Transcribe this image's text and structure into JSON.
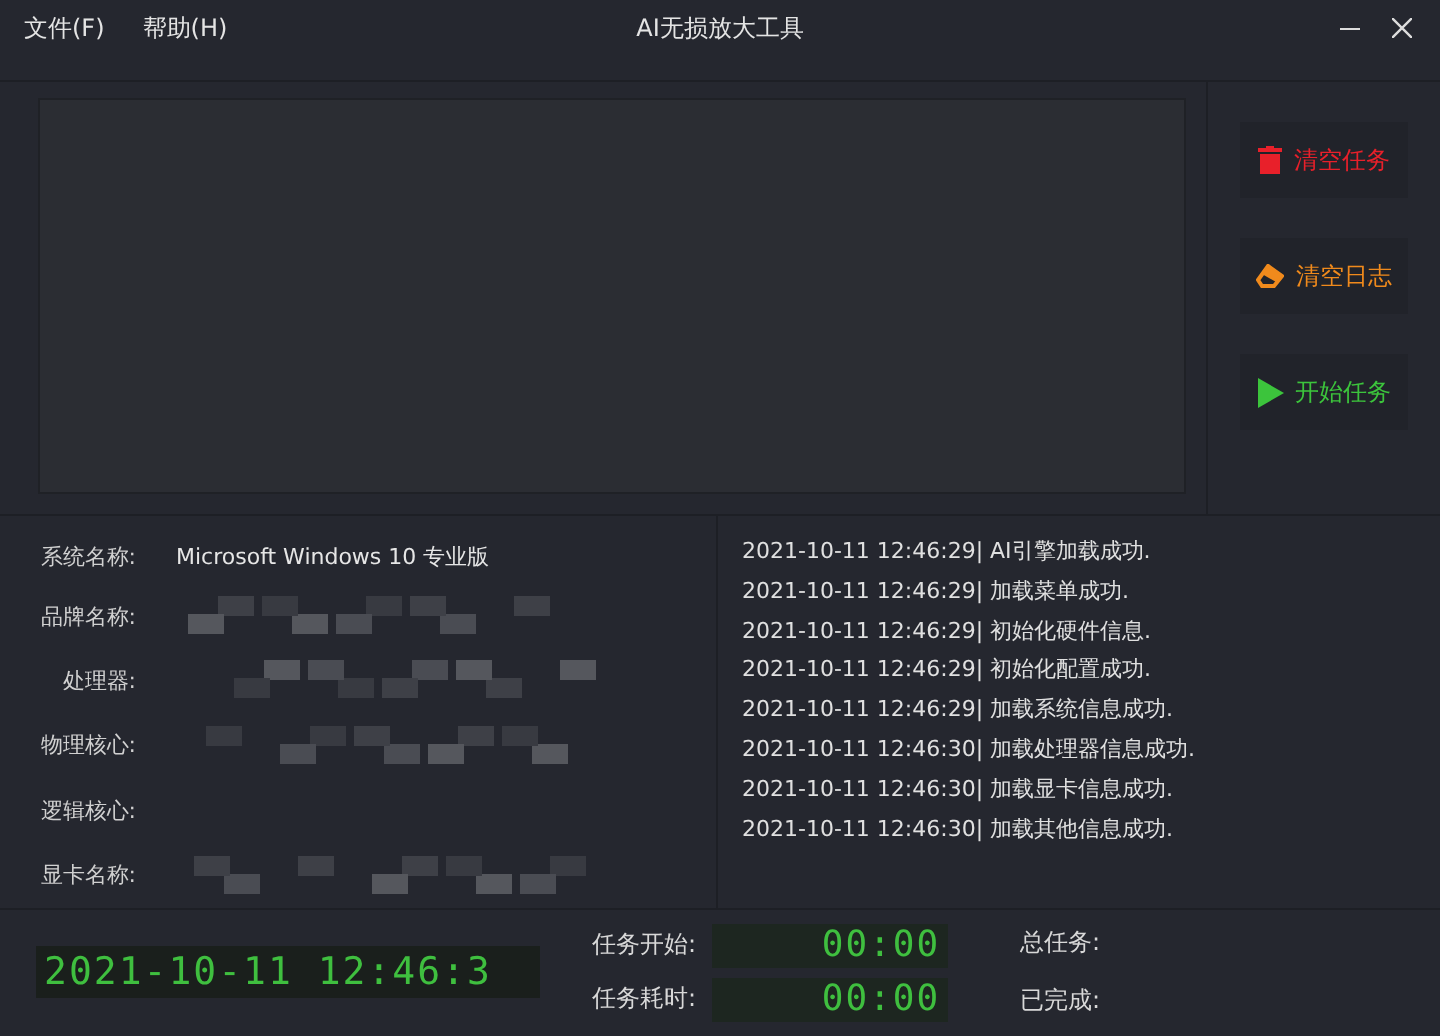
{
  "menu": [
    {
      "label": "文件(F)"
    },
    {
      "label": "帮助(H)"
    }
  ],
  "window": {
    "title": "AI无损放大工具"
  },
  "actions": [
    {
      "kind": "clear",
      "label": "清空任务",
      "color": "#e8202a"
    },
    {
      "kind": "erase",
      "label": "清空日志",
      "color": "#f08a1c"
    },
    {
      "kind": "start",
      "label": "开始任务",
      "color": "#3cc43c"
    }
  ],
  "system_info": [
    {
      "label": "系统名称:",
      "value": "Microsoft Windows 10 专业版"
    },
    {
      "label": "品牌名称:",
      "redacted": true
    },
    {
      "label": "处理器:",
      "redacted": true
    },
    {
      "label": "物理核心:",
      "redacted": true
    },
    {
      "label": "逻辑核心:"
    },
    {
      "label": "显卡名称:",
      "redacted": true
    }
  ],
  "log": [
    "2021-10-11 12:46:29| AI引擎加载成功.",
    "2021-10-11 12:46:29| 加载菜单成功.",
    "2021-10-11 12:46:29| 初始化硬件信息.",
    "2021-10-11 12:46:29| 初始化配置成功.",
    "2021-10-11 12:46:29| 加载系统信息成功.",
    "2021-10-11 12:46:30| 加载处理器信息成功.",
    "2021-10-11 12:46:30| 加载显卡信息成功.",
    "2021-10-11 12:46:30| 加载其他信息成功."
  ],
  "status": {
    "clock": "2021-10-11 12:46:3",
    "timers": [
      {
        "label": "任务开始:",
        "value": "00:00"
      },
      {
        "label": "任务耗时:",
        "value": "00:00"
      }
    ],
    "counts": [
      {
        "label": "总任务:"
      },
      {
        "label": "已完成:"
      }
    ]
  }
}
